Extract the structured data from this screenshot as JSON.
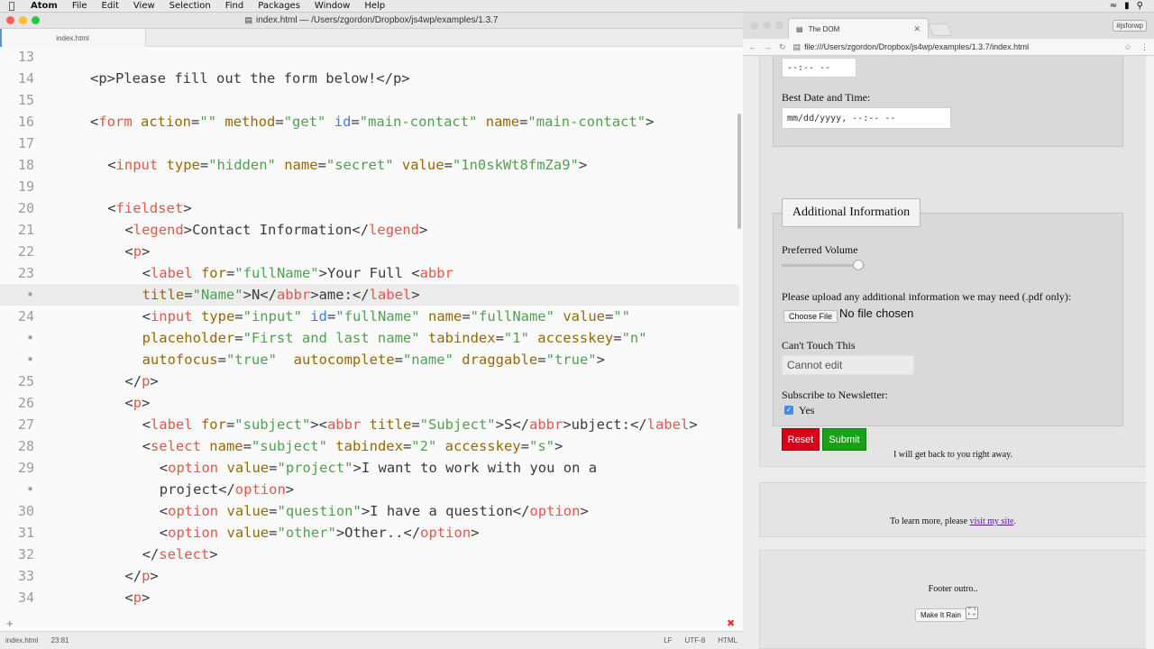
{
  "menubar": {
    "app": "Atom",
    "items": [
      "File",
      "Edit",
      "View",
      "Selection",
      "Find",
      "Packages",
      "Window",
      "Help"
    ],
    "tag": "#jsforwp"
  },
  "atom": {
    "title": "index.html — /Users/zgordon/Dropbox/js4wp/examples/1.3.7",
    "tab": "index.html",
    "status": {
      "file": "index.html",
      "position": "23:81",
      "eol": "LF",
      "encoding": "UTF-8",
      "grammar": "HTML"
    },
    "lines": [
      {
        "num": "13",
        "indent": 0,
        "tokens": []
      },
      {
        "num": "14",
        "indent": 2,
        "tokens": [
          [
            "p",
            "<p>"
          ],
          [
            "t",
            "Please fill out the form below!"
          ],
          [
            "p",
            "</p>"
          ]
        ]
      },
      {
        "num": "15",
        "indent": 0,
        "tokens": []
      },
      {
        "num": "16",
        "indent": 2,
        "tokens": [
          [
            "p",
            "<"
          ],
          [
            "tg",
            "form"
          ],
          [
            "t",
            " "
          ],
          [
            "at",
            "action"
          ],
          [
            "t",
            "="
          ],
          [
            "st",
            "\"\""
          ],
          [
            "t",
            " "
          ],
          [
            "at",
            "method"
          ],
          [
            "t",
            "="
          ],
          [
            "st",
            "\"get\""
          ],
          [
            "t",
            " "
          ],
          [
            "id",
            "id"
          ],
          [
            "t",
            "="
          ],
          [
            "st",
            "\"main-contact\""
          ],
          [
            "t",
            " "
          ],
          [
            "at",
            "name"
          ],
          [
            "t",
            "="
          ],
          [
            "st",
            "\"main-contact\""
          ],
          [
            "t",
            ">"
          ]
        ]
      },
      {
        "num": "17",
        "indent": 0,
        "tokens": []
      },
      {
        "num": "18",
        "indent": 3,
        "tokens": [
          [
            "p",
            "<"
          ],
          [
            "tg",
            "input"
          ],
          [
            "t",
            " "
          ],
          [
            "at",
            "type"
          ],
          [
            "t",
            "="
          ],
          [
            "st",
            "\"hidden\""
          ],
          [
            "t",
            " "
          ],
          [
            "at",
            "name"
          ],
          [
            "t",
            "="
          ],
          [
            "st",
            "\"secret\""
          ],
          [
            "t",
            " "
          ],
          [
            "at",
            "value"
          ],
          [
            "t",
            "="
          ],
          [
            "st",
            "\"1n0skWt8fmZa9\""
          ],
          [
            "t",
            ">"
          ]
        ]
      },
      {
        "num": "19",
        "indent": 0,
        "tokens": []
      },
      {
        "num": "20",
        "indent": 3,
        "tokens": [
          [
            "p",
            "<"
          ],
          [
            "tg",
            "fieldset"
          ],
          [
            "t",
            ">"
          ]
        ]
      },
      {
        "num": "21",
        "indent": 4,
        "tokens": [
          [
            "p",
            "<"
          ],
          [
            "tg",
            "legend"
          ],
          [
            "t",
            ">Contact Information</"
          ],
          [
            "tg",
            "legend"
          ],
          [
            "t",
            ">"
          ]
        ]
      },
      {
        "num": "22",
        "indent": 4,
        "tokens": [
          [
            "p",
            "<"
          ],
          [
            "tg",
            "p"
          ],
          [
            "t",
            ">"
          ]
        ]
      },
      {
        "num": "23",
        "indent": 5,
        "tokens": [
          [
            "p",
            "<"
          ],
          [
            "tg",
            "label"
          ],
          [
            "t",
            " "
          ],
          [
            "at",
            "for"
          ],
          [
            "t",
            "="
          ],
          [
            "st",
            "\"fullName\""
          ],
          [
            "t",
            ">Your Full <"
          ],
          [
            "tg",
            "abbr"
          ]
        ]
      },
      {
        "num": "•",
        "indent": 5,
        "cursor": true,
        "tokens": [
          [
            "at",
            "title"
          ],
          [
            "t",
            "="
          ],
          [
            "st",
            "\"Name\""
          ],
          [
            "t",
            ">N</"
          ],
          [
            "tg",
            "abbr"
          ],
          [
            "t",
            ">ame:</"
          ],
          [
            "tg",
            "label"
          ],
          [
            "t",
            ">"
          ]
        ]
      },
      {
        "num": "24",
        "indent": 5,
        "tokens": [
          [
            "p",
            "<"
          ],
          [
            "tg",
            "input"
          ],
          [
            "t",
            " "
          ],
          [
            "at",
            "type"
          ],
          [
            "t",
            "="
          ],
          [
            "st",
            "\"input\""
          ],
          [
            "t",
            " "
          ],
          [
            "id",
            "id"
          ],
          [
            "t",
            "="
          ],
          [
            "st",
            "\"fullName\""
          ],
          [
            "t",
            " "
          ],
          [
            "at",
            "name"
          ],
          [
            "t",
            "="
          ],
          [
            "st",
            "\"fullName\""
          ],
          [
            "t",
            " "
          ],
          [
            "at",
            "value"
          ],
          [
            "t",
            "="
          ],
          [
            "st",
            "\"\""
          ]
        ]
      },
      {
        "num": "•",
        "indent": 5,
        "tokens": [
          [
            "at",
            "placeholder"
          ],
          [
            "t",
            "="
          ],
          [
            "st",
            "\"First and last name\""
          ],
          [
            "t",
            " "
          ],
          [
            "at",
            "tabindex"
          ],
          [
            "t",
            "="
          ],
          [
            "st",
            "\"1\""
          ],
          [
            "t",
            " "
          ],
          [
            "at",
            "accesskey"
          ],
          [
            "t",
            "="
          ],
          [
            "st",
            "\"n\""
          ]
        ]
      },
      {
        "num": "•",
        "indent": 5,
        "tokens": [
          [
            "at",
            "autofocus"
          ],
          [
            "t",
            "="
          ],
          [
            "st",
            "\"true\""
          ],
          [
            "t",
            "  "
          ],
          [
            "at",
            "autocomplete"
          ],
          [
            "t",
            "="
          ],
          [
            "st",
            "\"name\""
          ],
          [
            "t",
            " "
          ],
          [
            "at",
            "draggable"
          ],
          [
            "t",
            "="
          ],
          [
            "st",
            "\"true\""
          ],
          [
            "t",
            ">"
          ]
        ]
      },
      {
        "num": "25",
        "indent": 4,
        "tokens": [
          [
            "t",
            "</"
          ],
          [
            "tg",
            "p"
          ],
          [
            "t",
            ">"
          ]
        ]
      },
      {
        "num": "26",
        "indent": 4,
        "tokens": [
          [
            "p",
            "<"
          ],
          [
            "tg",
            "p"
          ],
          [
            "t",
            ">"
          ]
        ]
      },
      {
        "num": "27",
        "indent": 5,
        "tokens": [
          [
            "p",
            "<"
          ],
          [
            "tg",
            "label"
          ],
          [
            "t",
            " "
          ],
          [
            "at",
            "for"
          ],
          [
            "t",
            "="
          ],
          [
            "st",
            "\"subject\""
          ],
          [
            "t",
            "><"
          ],
          [
            "tg",
            "abbr"
          ],
          [
            "t",
            " "
          ],
          [
            "at",
            "title"
          ],
          [
            "t",
            "="
          ],
          [
            "st",
            "\"Subject\""
          ],
          [
            "t",
            ">S</"
          ],
          [
            "tg",
            "abbr"
          ],
          [
            "t",
            ">ubject:</"
          ],
          [
            "tg",
            "label"
          ],
          [
            "t",
            ">"
          ]
        ]
      },
      {
        "num": "28",
        "indent": 5,
        "tokens": [
          [
            "p",
            "<"
          ],
          [
            "tg",
            "select"
          ],
          [
            "t",
            " "
          ],
          [
            "at",
            "name"
          ],
          [
            "t",
            "="
          ],
          [
            "st",
            "\"subject\""
          ],
          [
            "t",
            " "
          ],
          [
            "at",
            "tabindex"
          ],
          [
            "t",
            "="
          ],
          [
            "st",
            "\"2\""
          ],
          [
            "t",
            " "
          ],
          [
            "at",
            "accesskey"
          ],
          [
            "t",
            "="
          ],
          [
            "st",
            "\"s\""
          ],
          [
            "t",
            ">"
          ]
        ]
      },
      {
        "num": "29",
        "indent": 6,
        "tokens": [
          [
            "p",
            "<"
          ],
          [
            "tg",
            "option"
          ],
          [
            "t",
            " "
          ],
          [
            "at",
            "value"
          ],
          [
            "t",
            "="
          ],
          [
            "st",
            "\"project\""
          ],
          [
            "t",
            ">I want to work with you on a"
          ]
        ]
      },
      {
        "num": "•",
        "indent": 6,
        "tokens": [
          [
            "t",
            "project</"
          ],
          [
            "tg",
            "option"
          ],
          [
            "t",
            ">"
          ]
        ]
      },
      {
        "num": "30",
        "indent": 6,
        "tokens": [
          [
            "p",
            "<"
          ],
          [
            "tg",
            "option"
          ],
          [
            "t",
            " "
          ],
          [
            "at",
            "value"
          ],
          [
            "t",
            "="
          ],
          [
            "st",
            "\"question\""
          ],
          [
            "t",
            ">I have a question</"
          ],
          [
            "tg",
            "option"
          ],
          [
            "t",
            ">"
          ]
        ]
      },
      {
        "num": "31",
        "indent": 6,
        "tokens": [
          [
            "p",
            "<"
          ],
          [
            "tg",
            "option"
          ],
          [
            "t",
            " "
          ],
          [
            "at",
            "value"
          ],
          [
            "t",
            "="
          ],
          [
            "st",
            "\"other\""
          ],
          [
            "t",
            ">Other..</"
          ],
          [
            "tg",
            "option"
          ],
          [
            "t",
            ">"
          ]
        ]
      },
      {
        "num": "32",
        "indent": 5,
        "tokens": [
          [
            "t",
            "</"
          ],
          [
            "tg",
            "select"
          ],
          [
            "t",
            ">"
          ]
        ]
      },
      {
        "num": "33",
        "indent": 4,
        "tokens": [
          [
            "t",
            "</"
          ],
          [
            "tg",
            "p"
          ],
          [
            "t",
            ">"
          ]
        ]
      },
      {
        "num": "34",
        "indent": 4,
        "tokens": [
          [
            "p",
            "<"
          ],
          [
            "tg",
            "p"
          ],
          [
            "t",
            ">"
          ]
        ]
      }
    ]
  },
  "chrome": {
    "tab_title": "The DOM",
    "badge": "#jsforwp",
    "url": "file:///Users/zgordon/Dropbox/js4wp/examples/1.3.7/index.html"
  },
  "page": {
    "time_value": "--:-- --",
    "best_label": "Best Date and Time:",
    "datetime_value": "mm/dd/yyyy, --:-- --",
    "legend": "Additional Information",
    "volume_label": "Preferred Volume",
    "volume_level": 0.92,
    "upload_label": "Please upload any additional information we may need (.pdf only):",
    "choose_file": "Choose File",
    "no_file": "No file chosen",
    "cant_touch_label": "Can't Touch This",
    "cant_touch_value": "Cannot edit",
    "newsletter_label": "Subscribe to Newsletter:",
    "yes": "Yes",
    "reset": "Reset",
    "submit": "Submit",
    "get_back": "I will get back to you right away.",
    "learn_more": "To learn more, please ",
    "visit_link": "visit my site",
    "period": ".",
    "footer": "Footer outro..",
    "rain": "Make It Rain"
  }
}
